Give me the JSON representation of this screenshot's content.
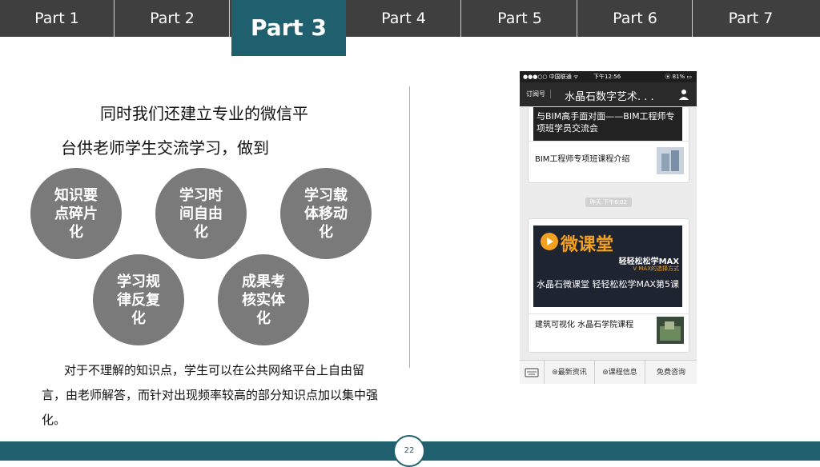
{
  "nav": {
    "tabs": [
      {
        "label": "Part 1"
      },
      {
        "label": "Part 2"
      },
      {
        "label": "Part 3"
      },
      {
        "label": "Part 4"
      },
      {
        "label": "Part 5"
      },
      {
        "label": "Part 6"
      },
      {
        "label": "Part 7"
      }
    ],
    "active_index": 2
  },
  "intro": {
    "line1": "同时我们还建立专业的微信平",
    "line2": "台供老师学生交流学习，做到"
  },
  "features": [
    {
      "label": "知识要点碎片化"
    },
    {
      "label": "学习时间自由化"
    },
    {
      "label": "学习载体移动化"
    },
    {
      "label": "学习规律反复化"
    },
    {
      "label": "成果考核实体化"
    }
  ],
  "body_text": "对于不理解的知识点，学生可以在公共网络平台上自由留言，由老师解答，而针对出现频率较高的部分知识点加以集中强化。",
  "phone": {
    "status": {
      "carrier": "●●●○○ 中国联通 ᯤ",
      "time": "下午12:56",
      "battery": "⦿ 81% ▭"
    },
    "header": {
      "subscribe": "订阅号",
      "title": "水晶石数字艺术. . ."
    },
    "card1": {
      "banner": "与BIM高手面对面——BIM工程师专项班学员交流会",
      "item": "BIM工程师专项班课程介绍"
    },
    "time_pill": "昨天 下午6:02",
    "card2": {
      "logo": "微课堂",
      "tag1": "轻轻松松学MAX",
      "tag2": "V MAX的选择方式",
      "caption": "水晶石微课堂 轻轻松松学MAX第5课",
      "item": "建筑可视化 水晶石学院课程"
    },
    "tabbar": [
      "⊜最新资讯",
      "⊜课程信息",
      "免费咨询"
    ]
  },
  "footer": {
    "page_number": "22"
  },
  "colors": {
    "accent": "#1f5f6e",
    "nav_bg": "#3f3f3f",
    "circle": "#7a7a7a"
  }
}
